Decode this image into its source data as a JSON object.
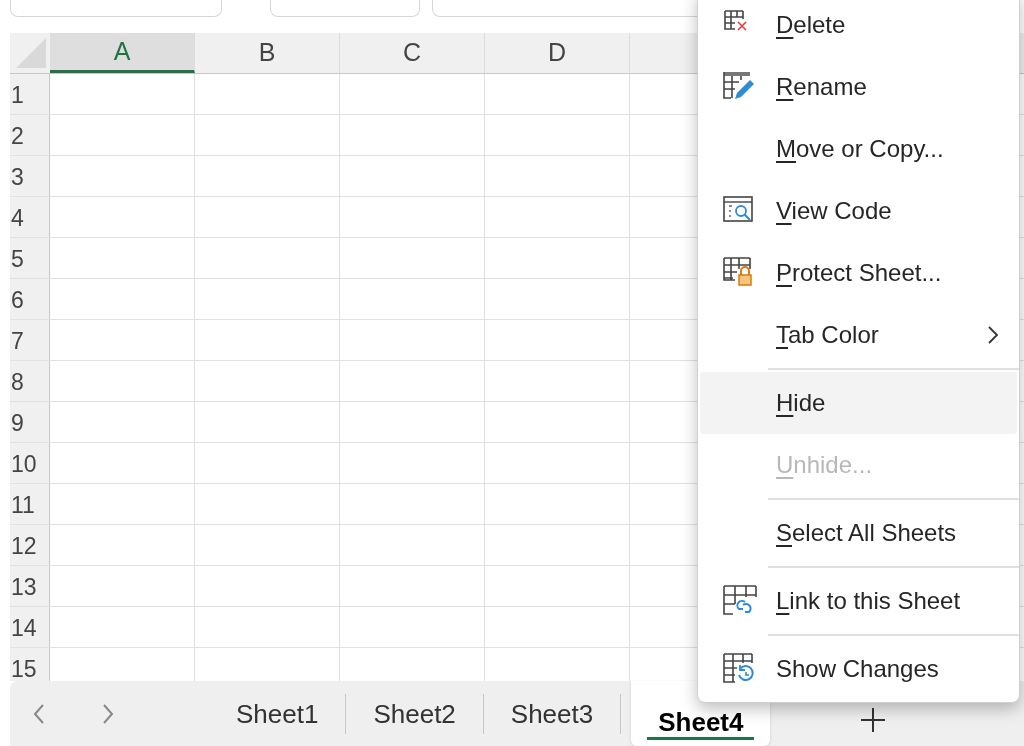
{
  "columns": [
    {
      "label": "A",
      "selected": true
    },
    {
      "label": "B",
      "selected": false
    },
    {
      "label": "C",
      "selected": false
    },
    {
      "label": "D",
      "selected": false
    }
  ],
  "rows": [
    "1",
    "2",
    "3",
    "4",
    "5",
    "6",
    "7",
    "8",
    "9",
    "10",
    "11",
    "12",
    "13",
    "14",
    "15"
  ],
  "sheet_tabs": [
    {
      "label": "Sheet1",
      "selected": false
    },
    {
      "label": "Sheet2",
      "selected": false
    },
    {
      "label": "Sheet3",
      "selected": false
    },
    {
      "label": "Sheet4",
      "selected": true
    }
  ],
  "context_menu": [
    {
      "kind": "item",
      "label": "Delete",
      "underlined": true,
      "disabled": false,
      "highlighted": false,
      "submenu": false
    },
    {
      "kind": "item",
      "label": "Rename",
      "underlined": true,
      "disabled": false,
      "highlighted": false,
      "submenu": false
    },
    {
      "kind": "item",
      "label": "Move or Copy...",
      "underlined": true,
      "disabled": false,
      "highlighted": false,
      "submenu": false
    },
    {
      "kind": "item",
      "label": "View Code",
      "underlined": true,
      "disabled": false,
      "highlighted": false,
      "submenu": false
    },
    {
      "kind": "item",
      "label": "Protect Sheet...",
      "underlined": true,
      "disabled": false,
      "highlighted": false,
      "submenu": false
    },
    {
      "kind": "item",
      "label": "Tab Color",
      "underlined": true,
      "disabled": false,
      "highlighted": false,
      "submenu": true
    },
    {
      "kind": "separator"
    },
    {
      "kind": "item",
      "label": "Hide",
      "underlined": true,
      "disabled": false,
      "highlighted": true,
      "submenu": false
    },
    {
      "kind": "item",
      "label": "Unhide...",
      "underlined": true,
      "disabled": true,
      "highlighted": false,
      "submenu": false
    },
    {
      "kind": "separator"
    },
    {
      "kind": "item",
      "label": "Select All Sheets",
      "underlined": true,
      "disabled": false,
      "highlighted": false,
      "submenu": false
    },
    {
      "kind": "separator"
    },
    {
      "kind": "item",
      "label": "Link to this Sheet",
      "underlined": true,
      "disabled": false,
      "highlighted": false,
      "submenu": false
    },
    {
      "kind": "separator"
    },
    {
      "kind": "item",
      "label": "Show Changes",
      "underlined": false,
      "disabled": false,
      "highlighted": false,
      "submenu": false
    }
  ]
}
